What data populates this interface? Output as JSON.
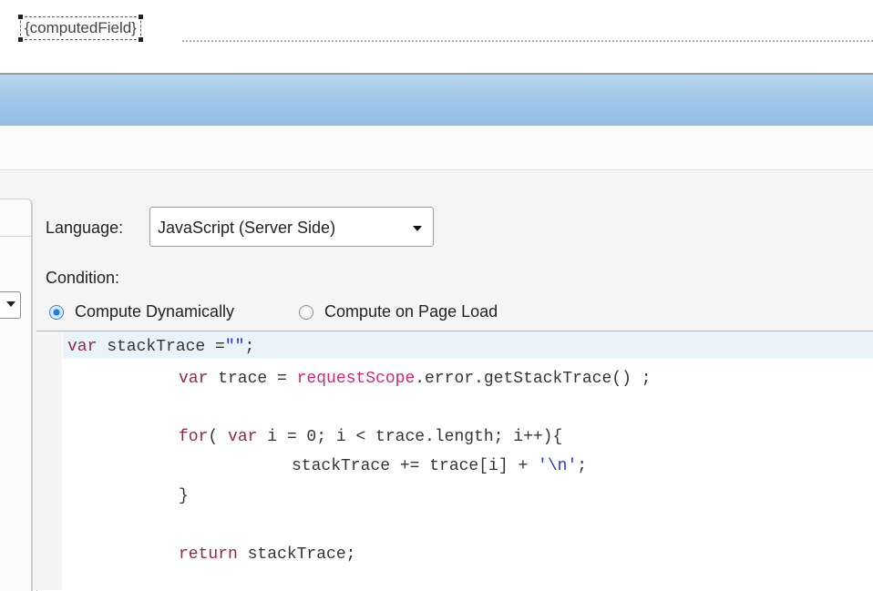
{
  "design": {
    "computed_field_label": "{computedField}"
  },
  "properties": {
    "language_label": "Language:",
    "language_value": "JavaScript (Server Side)",
    "condition_label": "Condition:",
    "radio_dynamic": "Compute Dynamically",
    "radio_page_load": "Compute on Page Load",
    "selected_option": "Compute Dynamically"
  },
  "code": {
    "line1_kw": "var",
    "line1_text": " stackTrace =",
    "line1_str": "\"\"",
    "line1_end": ";",
    "line2_kw": "var",
    "line2_text": " trace = ",
    "line2_fn": "requestScope",
    "line2_end": ".error.getStackTrace() ;",
    "line3_kw1": "for",
    "line3_mid": "( ",
    "line3_kw2": "var",
    "line3_end": " i = 0; i < trace.length; i++){",
    "line4_text": "stackTrace += trace[i] + ",
    "line4_str": "'\\n'",
    "line4_end": ";",
    "line5_text": "}",
    "line6_kw": "return",
    "line6_end": " stackTrace;"
  },
  "colors": {
    "header_blue": "#a2c8e8",
    "keyword": "#8a2a4a",
    "string": "#2a37c9",
    "identifier": "#c12e7c"
  }
}
